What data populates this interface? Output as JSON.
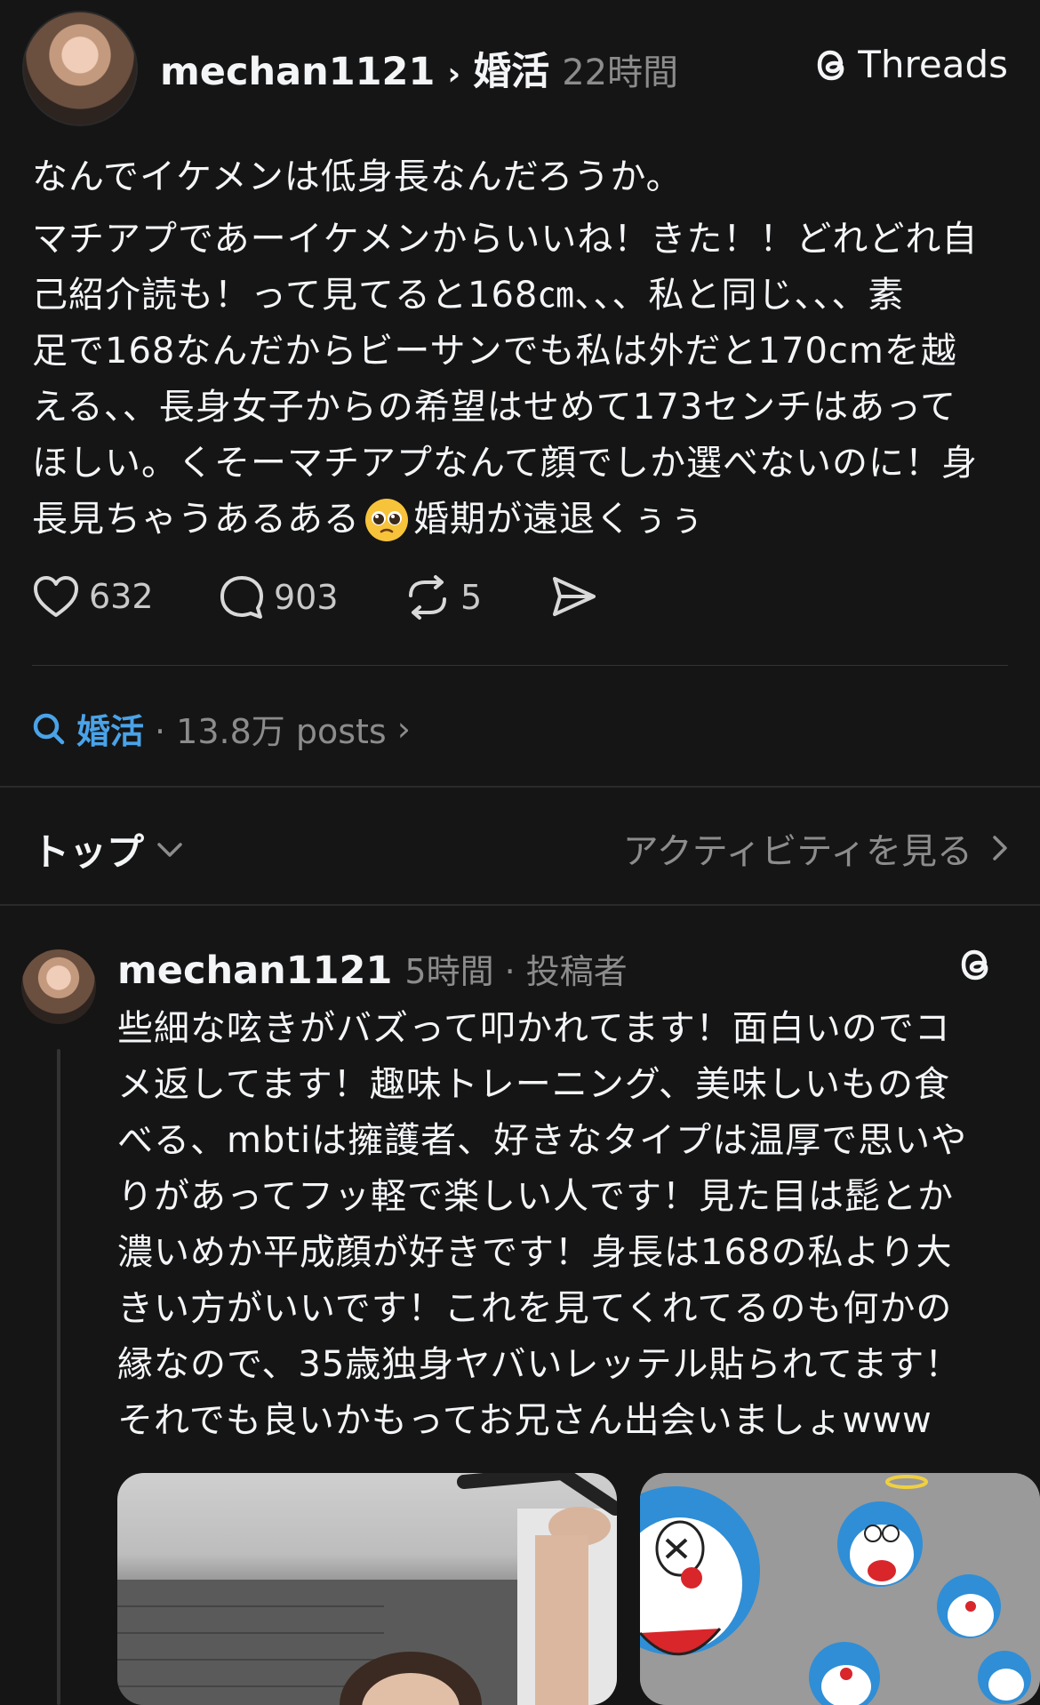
{
  "post": {
    "username": "mechan1121",
    "topic": "婚活",
    "time": "22時間",
    "brand": "Threads",
    "text_title": "なんでイケメンは低身長なんだろうか。",
    "text_lines": [
      "マチアプであーイケメンからいいね！きた！！どれどれ自",
      "己紹介読も！って見てると168㎝、、、私と同じ、、、素",
      "足で168なんだからビーサンでも私は外だと170cmを越",
      "える、、長身女子からの希望はせめて173センチはあって",
      "ほしい。くそーマチアプなんて顔でしか選べないのに！身"
    ],
    "text_last_a": "長見ちゃうあるある",
    "text_last_b": "婚期が遠退くぅぅ",
    "likes": "632",
    "replies": "903",
    "reposts": "5"
  },
  "topic_link": {
    "tag": "婚活",
    "count": "· 13.8万 posts",
    "chevron": "›"
  },
  "sort": {
    "label": "トップ",
    "activity": "アクティビティを見る"
  },
  "reply": {
    "username": "mechan1121",
    "meta": "5時間 · 投稿者",
    "text_lines": [
      "些細な呟きがバズって叩かれてます！面白いのでコ",
      "メ返してます！趣味トレーニング、美味しいもの食",
      "べる、mbtiは擁護者、好きなタイプは温厚で思いや",
      "りがあってフッ軽で楽しい人です！見た目は髭とか",
      "濃いめか平成顔が好きです！身長は168の私より大",
      "きい方がいいです！これを見てくれてるのも何かの",
      "縁なので、35歳独身ヤバいレッテル貼られてます！",
      "それでも良いかもってお兄さん出会いましょwww"
    ]
  },
  "icons": {
    "like": "heart-icon",
    "reply": "comment-bubble-icon",
    "repost": "repost-icon",
    "share": "send-icon",
    "search": "search-icon",
    "threads": "threads-logo-icon",
    "emoji": "pleading-face-emoji"
  },
  "colors": {
    "background": "#151515",
    "text": "#f3f5f7",
    "muted": "#8c8c8c",
    "link": "#4aa3e8"
  }
}
